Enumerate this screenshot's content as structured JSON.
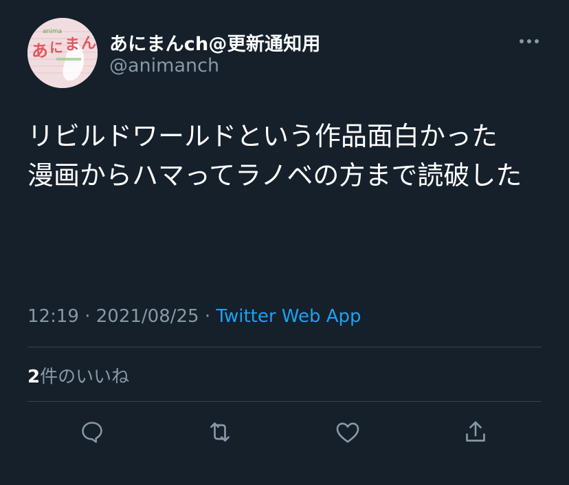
{
  "user": {
    "display_name": "あにまんch@更新通知用",
    "handle": "@animanch"
  },
  "tweet": {
    "text": "リビルドワールドという作品面白かった\n漫画からハマってラノベの方まで読破した",
    "time": "12:19",
    "separator": " · ",
    "date": "2021/08/25",
    "source": "Twitter Web App"
  },
  "stats": {
    "like_count": "2",
    "like_label": "件のいいね"
  },
  "actions": [
    {
      "icon": "reply-icon"
    },
    {
      "icon": "retweet-icon"
    },
    {
      "icon": "like-icon"
    },
    {
      "icon": "share-icon"
    }
  ],
  "colors": {
    "background": "#15202b",
    "text_primary": "#ffffff",
    "text_secondary": "#8899a6",
    "accent": "#1da1f2",
    "divider": "#38444d"
  }
}
